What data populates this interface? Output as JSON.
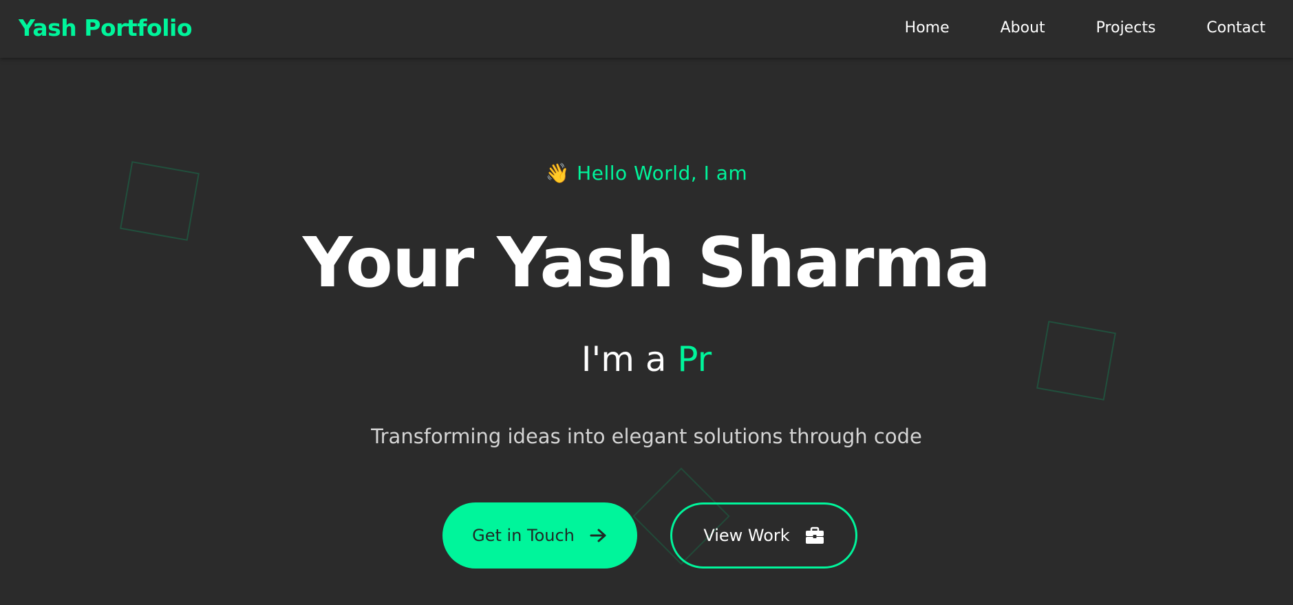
{
  "navbar": {
    "brand": "Yash Portfolio",
    "links": [
      {
        "label": "Home"
      },
      {
        "label": "About"
      },
      {
        "label": "Projects"
      },
      {
        "label": "Contact"
      }
    ]
  },
  "hero": {
    "greeting_icon": "👋",
    "greeting": "Hello World, I am",
    "name": "Your Yash Sharma",
    "role_prefix": "I'm a ",
    "role_typed": "Pr",
    "tagline": "Transforming ideas into elegant solutions through code"
  },
  "buttons": {
    "primary": {
      "label": "Get in Touch",
      "icon": "arrow-right-icon"
    },
    "secondary": {
      "label": "View Work",
      "icon": "briefcase-icon"
    }
  },
  "colors": {
    "accent": "#00f59b",
    "background": "#2b2b2b",
    "text": "#ffffff"
  }
}
